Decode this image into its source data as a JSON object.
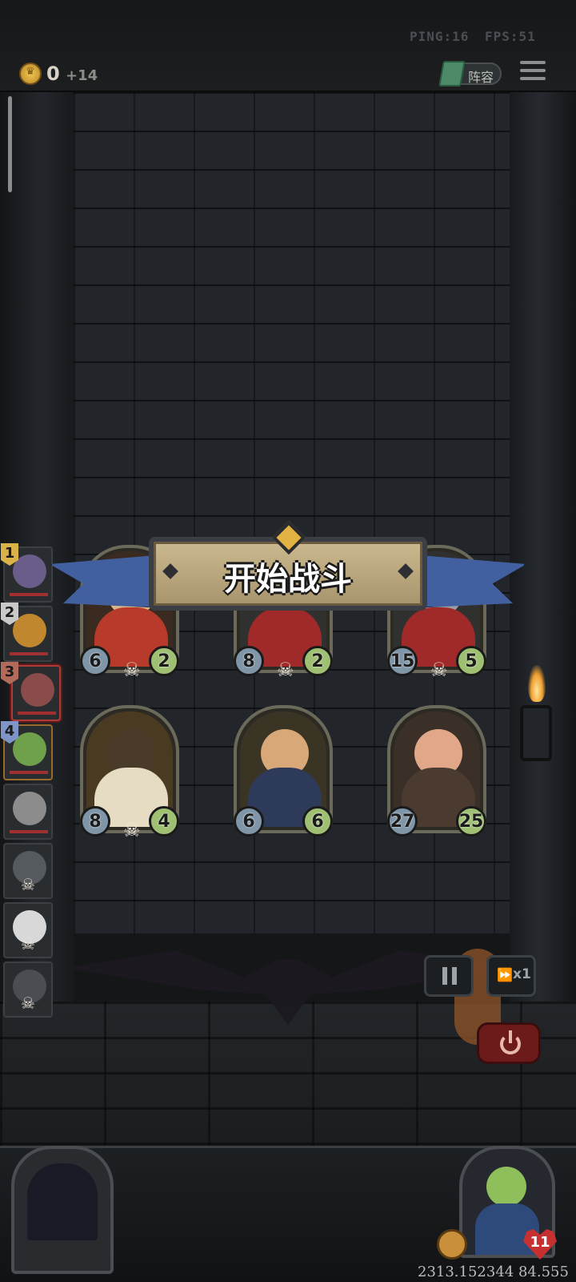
{
  "hud": {
    "ping": "PING:16",
    "fps": "FPS:51",
    "gold": "0",
    "gold_income": "+14",
    "lineup_label": "阵容",
    "menu_icon": "menu-icon",
    "coin_icon": "crown-coin-icon"
  },
  "banner": {
    "title": "开始战斗"
  },
  "sidebar": {
    "slots": [
      {
        "num": "1",
        "num_color": "#d9b24a"
      },
      {
        "num": "2",
        "num_color": "#c9c9c9"
      },
      {
        "num": "3",
        "num_color": "#b26a5a"
      },
      {
        "num": "4",
        "num_color": "#7f95c8"
      },
      {
        "num": ""
      },
      {
        "num": ""
      },
      {
        "num": ""
      },
      {
        "num": ""
      }
    ]
  },
  "board": {
    "cards": [
      {
        "attack": "6",
        "health": "2"
      },
      {
        "attack": "8",
        "health": "2"
      },
      {
        "attack": "15",
        "health": "5"
      },
      {
        "attack": "8",
        "health": "4"
      },
      {
        "attack": "6",
        "health": "6"
      },
      {
        "attack": "27",
        "health": "25"
      }
    ]
  },
  "controls": {
    "speed_label": "x1",
    "pause_icon": "pause-icon",
    "fast_forward_icon": "fast-forward-icon",
    "power_icon": "power-icon"
  },
  "hero": {
    "health": "11"
  },
  "footer": {
    "id_text": "2313.152344 84.555"
  }
}
